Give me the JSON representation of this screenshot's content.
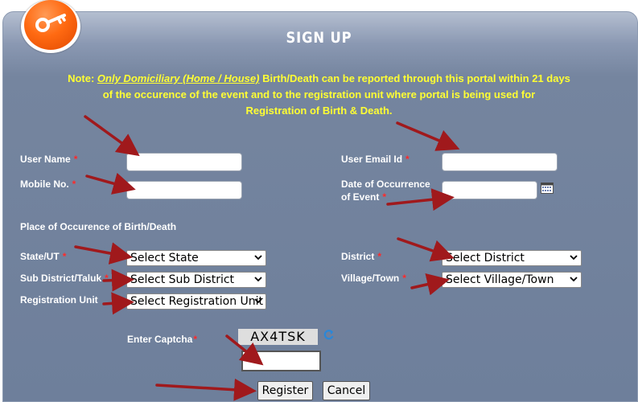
{
  "header": {
    "title": "SIGN UP",
    "icon": "key-icon",
    "accent": "#ff6a12"
  },
  "note": {
    "prefix": "Note:",
    "highlight": "Only Domiciliary (Home / House)",
    "line1_rest": " Birth/Death can be reported through this portal within 21 days",
    "line2": "of the occurence of the event and to the registration unit where portal is being used for",
    "line3": "Registration of Birth & Death."
  },
  "form": {
    "user_name_label": "User Name",
    "user_email_label": "User Email Id",
    "mobile_label": "Mobile No.",
    "date_label_line1": "Date of Occurrence",
    "date_label_line2": "of Event",
    "place_heading": "Place of Occurence of Birth/Death",
    "state_label": "State/UT",
    "state_value": "Select State",
    "district_label": "District",
    "district_value": "Select District",
    "subdistrict_label": "Sub District/Taluk",
    "subdistrict_value": "Select Sub District",
    "village_label": "Village/Town",
    "village_value": "Select Village/Town",
    "reg_unit_label": "Registration Unit",
    "reg_unit_value": "Select Registration Unit",
    "captcha_label": "Enter Captcha",
    "captcha_text": "AX4TSK",
    "required_mark": "*"
  },
  "buttons": {
    "register": "Register",
    "cancel": "Cancel"
  },
  "colors": {
    "note": "#ffff33",
    "required": "#ff2a2a",
    "arrow": "#a0191c"
  }
}
